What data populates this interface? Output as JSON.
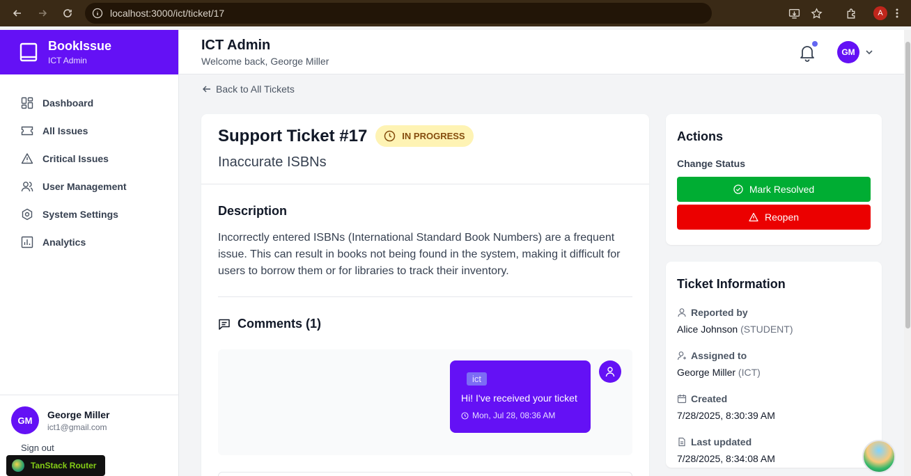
{
  "browser": {
    "url": "localhost:3000/ict/ticket/17",
    "profile_initial": "A"
  },
  "sidebar": {
    "brand_title": "BookIssue",
    "brand_sub": "ICT Admin",
    "items": [
      {
        "label": "Dashboard",
        "icon": "dashboard-icon"
      },
      {
        "label": "All Issues",
        "icon": "ticket-icon"
      },
      {
        "label": "Critical Issues",
        "icon": "warning-icon"
      },
      {
        "label": "User Management",
        "icon": "users-icon"
      },
      {
        "label": "System Settings",
        "icon": "settings-icon"
      },
      {
        "label": "Analytics",
        "icon": "analytics-icon"
      }
    ],
    "user": {
      "initials": "GM",
      "name": "George Miller",
      "email": "ict1@gmail.com",
      "signout": "Sign out"
    }
  },
  "header": {
    "title": "ICT Admin",
    "subtitle": "Welcome back, George Miller",
    "avatar_initials": "GM"
  },
  "main": {
    "back_label": "Back to All Tickets",
    "ticket": {
      "title": "Support Ticket #17",
      "status": "IN PROGRESS",
      "subtitle": "Inaccurate ISBNs",
      "description_heading": "Description",
      "description": "Incorrectly entered ISBNs (International Standard Book Numbers) are a frequent issue. This can result in books not being found in the system, making it difficult for users to borrow them or for libraries to track their inventory.",
      "comments_heading": "Comments (1)",
      "comments": [
        {
          "role": "ict",
          "text": "Hi! I've received your ticket",
          "time": "Mon, Jul 28, 08:36 AM"
        }
      ]
    },
    "actions": {
      "heading": "Actions",
      "change_status_label": "Change Status",
      "resolve_label": "Mark Resolved",
      "reopen_label": "Reopen"
    },
    "info": {
      "heading": "Ticket Information",
      "reported_label": "Reported by",
      "reported_name": "Alice Johnson",
      "reported_role": "(STUDENT)",
      "assigned_label": "Assigned to",
      "assigned_name": "George Miller",
      "assigned_role": "(ICT)",
      "created_label": "Created",
      "created_value": "7/28/2025, 8:30:39 AM",
      "updated_label": "Last updated",
      "updated_value": "7/28/2025, 8:34:08 AM"
    }
  },
  "devtools": {
    "tanstack_label": "TanStack Router"
  },
  "colors": {
    "brand": "#6411f5",
    "resolve": "#00ad33",
    "reopen": "#eb0000",
    "status_bg": "#fef3b4"
  }
}
